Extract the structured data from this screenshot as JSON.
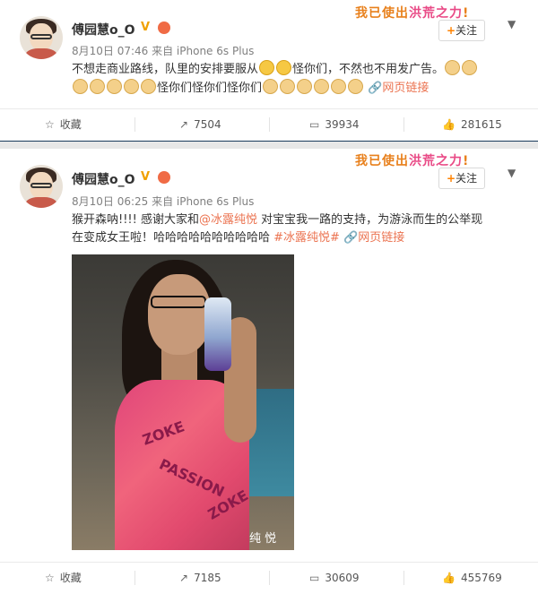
{
  "banner_left": "我已使出",
  "banner_hl": "洪荒之力",
  "banner_end": "!",
  "follow_label": "关注",
  "posts": [
    {
      "name": "傅园慧o_O",
      "vip": "V",
      "time_source": "8月10日 07:46 来自 iPhone 6s Plus",
      "text1": "不想走商业路线，队里的安排要服从",
      "text2": "怪你们，不然也不用发广告。",
      "text3": "怪你们怪你们怪你们",
      "link": "网页链接",
      "actions": {
        "fav": "收藏",
        "repost": "7504",
        "comment": "39934",
        "like": "281615"
      }
    },
    {
      "name": "傅园慧o_O",
      "vip": "V",
      "time_source": "8月10日 06:25 来自 iPhone 6s Plus",
      "text_a": "猴开森呐!!!! 感谢大家和",
      "mention": "@冰露纯悦",
      "text_b": " 对宝宝我一路的支持，为游泳而生的公举现",
      "text_c": "在变成女王啦！哈哈哈哈哈哈哈哈哈哈 ",
      "hashtag": "#冰露纯悦#",
      "link": "网页链接",
      "watermark": "纯 悦",
      "suit_words": [
        "ZOKE",
        "PASSION"
      ],
      "actions": {
        "fav": "收藏",
        "repost": "7185",
        "comment": "30609",
        "like": "455769"
      }
    }
  ],
  "colors": {
    "accent": "#eb7350",
    "orange": "#ff8200",
    "banner": "#e8801c"
  }
}
